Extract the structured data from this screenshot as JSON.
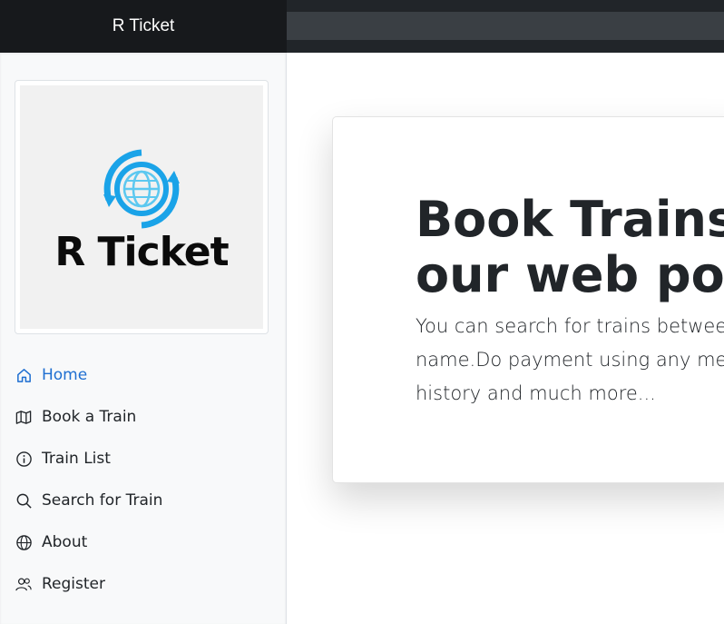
{
  "header": {
    "brand": "R Ticket"
  },
  "sidebar": {
    "logo_text": "R Ticket",
    "items": [
      {
        "label": "Home",
        "icon": "house-icon",
        "active": true
      },
      {
        "label": "Book a Train",
        "icon": "map-icon",
        "active": false
      },
      {
        "label": "Train List",
        "icon": "info-circle-icon",
        "active": false
      },
      {
        "label": "Search for Train",
        "icon": "search-icon",
        "active": false
      },
      {
        "label": "About",
        "icon": "globe-icon",
        "active": false
      },
      {
        "label": "Register",
        "icon": "people-icon",
        "active": false
      }
    ]
  },
  "hero": {
    "title_line1": "Book Trains",
    "title_line2": "our web por",
    "description": "You can search for trains betweer\nname.Do payment using any me\nhistory and much more..."
  },
  "colors": {
    "topbar": "#212529",
    "active_link": "#1f6fd1",
    "logo_blue": "#1aa3e8"
  }
}
